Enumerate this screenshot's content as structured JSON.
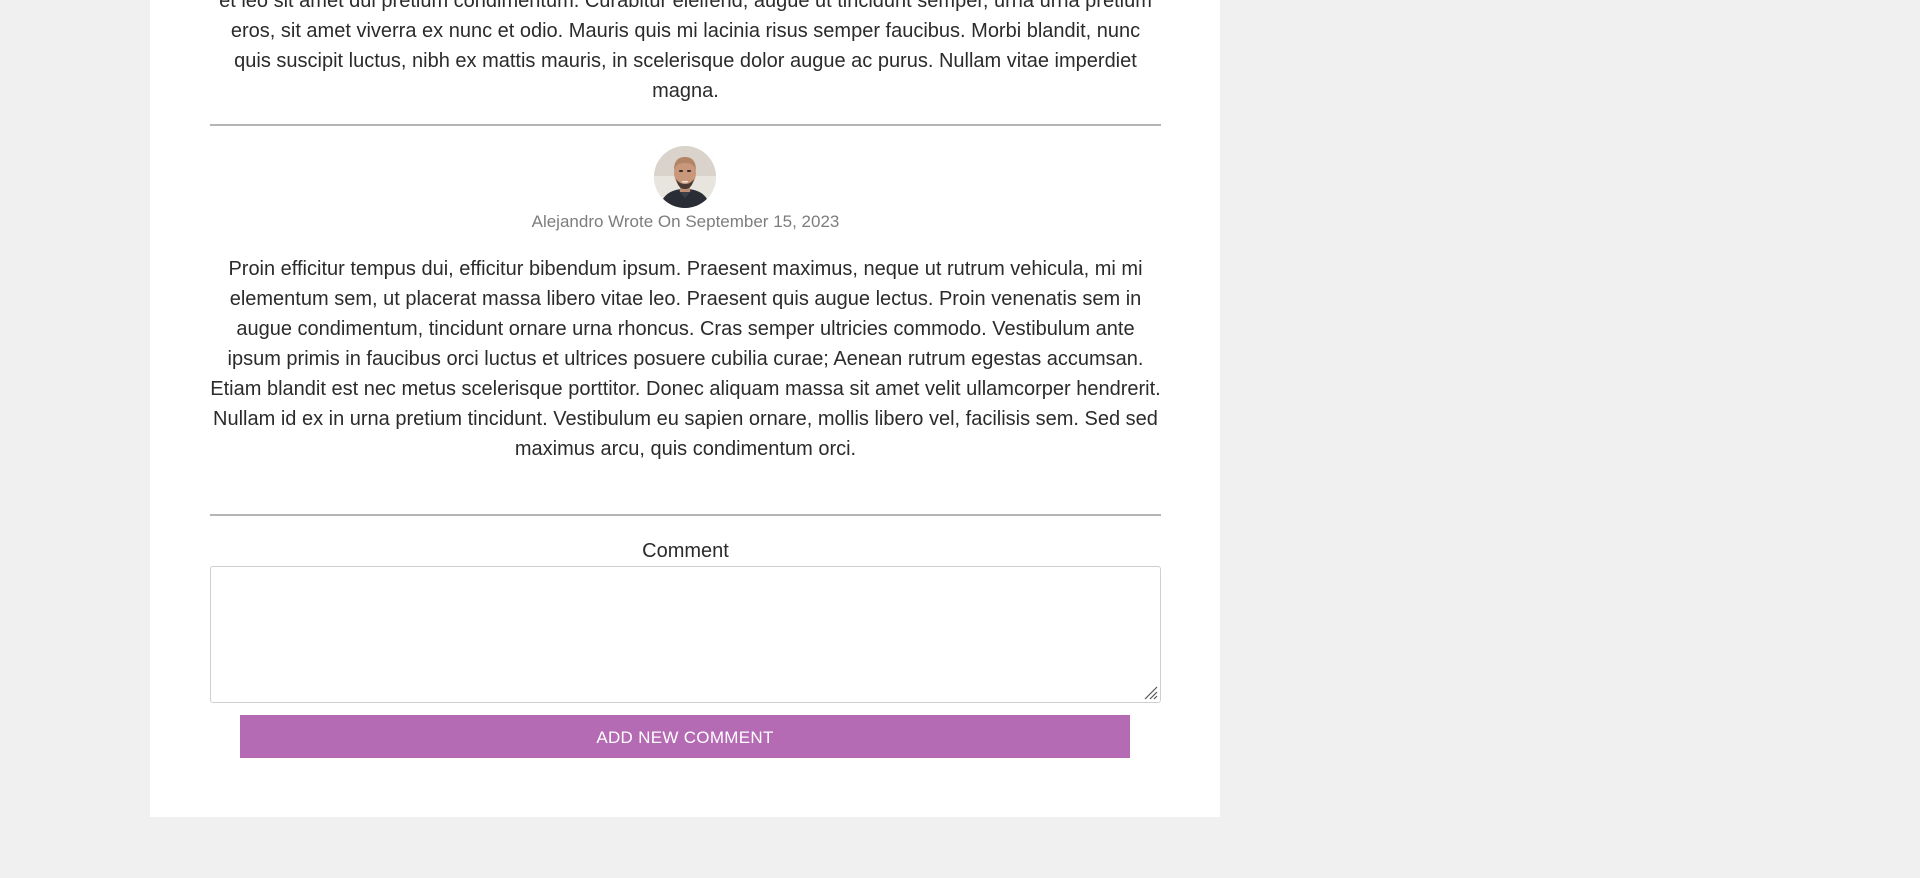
{
  "previous_comment": {
    "text": "et leo sit amet dui pretium condimentum. Curabitur eleifend, augue ut tincidunt semper, urna urna pretium eros, sit amet viverra ex nunc et odio. Mauris quis mi lacinia risus semper faucibus. Morbi blandit, nunc quis suscipit luctus, nibh ex mattis mauris, in scelerisque dolor augue ac purus. Nullam vitae imperdiet magna."
  },
  "comment": {
    "avatar_icon": "user-avatar-photo",
    "meta": "Alejandro Wrote On September 15, 2023",
    "text": "Proin efficitur tempus dui, efficitur bibendum ipsum. Praesent maximus, neque ut rutrum vehicula, mi mi elementum sem, ut placerat massa libero vitae leo. Praesent quis augue lectus. Proin venenatis sem in augue condimentum, tincidunt ornare urna rhoncus. Cras semper ultricies commodo. Vestibulum ante ipsum primis in faucibus orci luctus et ultrices posuere cubilia curae; Aenean rutrum egestas accumsan. Etiam blandit est nec metus scelerisque porttitor. Donec aliquam massa sit amet velit ullamcorper hendrerit. Nullam id ex in urna pretium tincidunt. Vestibulum eu sapien ornare, mollis libero vel, facilisis sem. Sed sed maximus arcu, quis condimentum orci."
  },
  "form": {
    "label": "Comment",
    "textarea_value": "",
    "submit_label": "ADD NEW COMMENT"
  },
  "colors": {
    "accent": "#b56ab4",
    "page_bg": "#f0f0f0",
    "card_bg": "#ffffff",
    "meta_text": "#7d7d7d"
  }
}
